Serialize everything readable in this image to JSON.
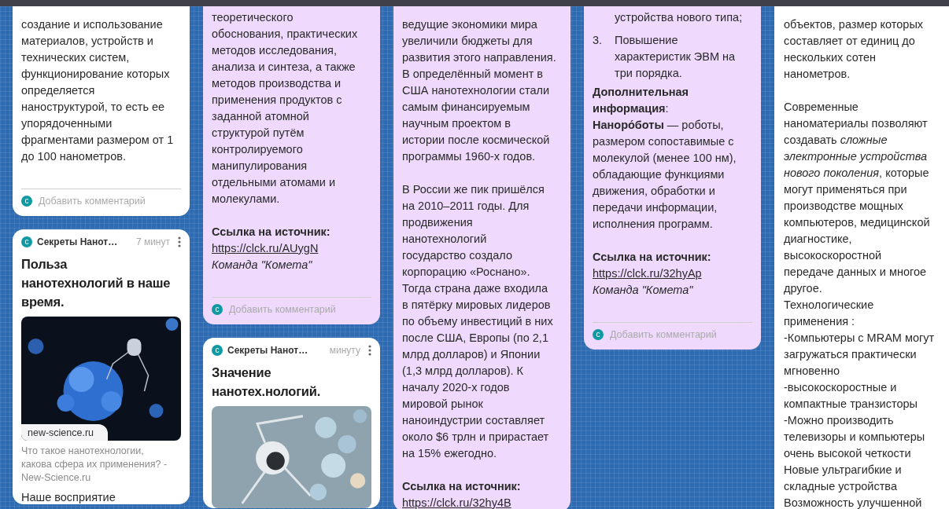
{
  "columns": [
    {
      "cards": [
        {
          "color": "#ffffff",
          "body": [
            {
              "kind": "text",
              "text": "создание и использование\nматериалов, устройств и\nтехнических систем,\nфункционирование которых\nопределяется\nнаноструктурой, то есть ее\nупорядоченными\nфрагментами размером от 1\nдо 100 нанометров."
            }
          ],
          "comment": {
            "avatar": "с",
            "placeholder": "Добавить комментарий"
          }
        },
        {
          "color": "#ffffff",
          "header": {
            "avatar": "с",
            "author": "Секреты Нанот…",
            "time": "7 минут"
          },
          "title": "Польза\nнанотехнологий в наше\nвремя.",
          "image": {
            "kind": "picture",
            "source": "new-science.ru"
          },
          "caption": "Что такое нанотехнологии,\nкакова сфера их применения? -\nNew-Science.ru",
          "body": [
            {
              "kind": "text",
              "text": "Наше восприятие"
            }
          ]
        }
      ]
    },
    {
      "cards": [
        {
          "color": "#efd9fd",
          "body": [
            {
              "kind": "text",
              "text": "теоретического\nобоснования, практических\nметодов исследования,\nанализа и синтеза, а также\nметодов производства и\nприменения продуктов с\nзаданной атомной\nструктурой путём\nконтролируемого\nманипулирования\nотдельными атомами и\nмолекулами."
            },
            {
              "kind": "label",
              "text": "Ссылка на источник:"
            },
            {
              "kind": "link",
              "text": "https://clck.ru/AUygN"
            },
            {
              "kind": "signature",
              "text": "Команда \"Комета\""
            }
          ],
          "comment": {
            "avatar": "с",
            "placeholder": "Добавить комментарий"
          }
        },
        {
          "color": "#ffffff",
          "header": {
            "avatar": "с",
            "author": "Секреты Нанот…",
            "time": "минуту"
          },
          "title": "Значение\nнанотех.нологий."
        }
      ]
    },
    {
      "cards": [
        {
          "color": "#efd9fd",
          "body": [
            {
              "kind": "text",
              "text": "ведущие экономики мира\nувеличили бюджеты для\nразвития этого направления.\nВ определённый момент в\nСША нанотехнологии стали\nсамым финансируемым\nнаучным проектом в\nистории после космической\nпрограммы 1960-х годов."
            },
            {
              "kind": "text",
              "text": "В России же пик пришёлся\nна 2010–2011 годы. Для\nпродвижения\nнанотехнологий\nгосударство создало\nкорпорацию «Роснано».\nТогда страна даже входила\nв пятёрку мировых лидеров\nпо объему инвестиций в них\nпосле США, Европы (по 2,1\nмлрд долларов) и Японии\n(1,3 млрд долларов). К\nначалу 2020-х годов\nмировой рынок\nнаноиндустрии составляет\nоколо $6 трлн и прирастает\nна 15% ежегодно."
            },
            {
              "kind": "label",
              "text": "Ссылка на источник:"
            },
            {
              "kind": "link",
              "text": "https://clck.ru/32hy4B"
            }
          ]
        }
      ]
    },
    {
      "cards": [
        {
          "color": "#efd9fd",
          "body": [
            {
              "kind": "continuation",
              "text": "устройства нового типа;"
            },
            {
              "kind": "numbered",
              "number": "3.",
              "text": "Повышение\nхарактеристик ЭВМ на\nтри порядка."
            },
            {
              "kind": "text",
              "text": "**Дополнительная**\n**информация**:\n**Наноро́боты** — роботы,\nразмером сопоставимые с\nмолекулой (менее 100 нм),\nобладающие функциями\nдвижения, обработки и\nпередачи информации,\nисполнения программ."
            },
            {
              "kind": "label",
              "text": "Ссылка на источник:"
            },
            {
              "kind": "link",
              "text": "https://clck.ru/32hyAp"
            },
            {
              "kind": "signature",
              "text": "Команда \"Комета\""
            }
          ],
          "comment": {
            "avatar": "с",
            "placeholder": "Добавить комментарий"
          }
        }
      ]
    },
    {
      "cards": [
        {
          "color": "#ffffff",
          "body": [
            {
              "kind": "text",
              "text": "объектов, размер которых\nсоставляет от единиц до\nнескольких сотен\nнанометров."
            },
            {
              "kind": "text",
              "text": "Современные\nнаноматериалы позволяют\nсоздавать *сложные*\n*электронные устройства*\n*нового поколения*, которые\nмогут применяться при\nпроизводстве мощных\nкомпьютеров, медицинской\nдиагностике,\nвысокоскоростной\nпередаче данных и многое\nдругое.\nТехнологические\nприменения :\n-Компьютеры с MRAM могут\nзагружаться практически\nмгновенно\n-высокоскоростные и\nкомпактные транзисторы\n-Можно производить\nтелевизоры и компьютеры\nочень высокой четкости\nНовые ультрагибкие и\nскладные устройства\nВозможность улучшенной"
            }
          ]
        }
      ]
    }
  ]
}
